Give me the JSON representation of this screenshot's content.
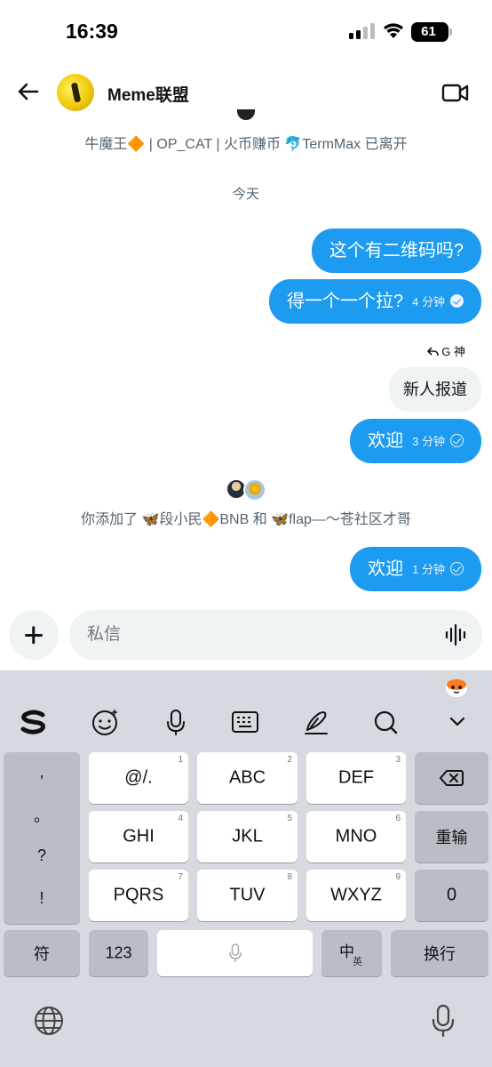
{
  "status_bar": {
    "time": "16:39",
    "battery": "61"
  },
  "header": {
    "title": "Meme联盟"
  },
  "chat": {
    "left_system": "牛魔王🔶 | OP_CAT | 火币赚币 🐬TermMax 已离开",
    "date": "今天",
    "messages": [
      {
        "text": "这个有二维码吗?"
      },
      {
        "text": "得一个一个拉?",
        "time": "4 分钟"
      }
    ],
    "reply_label": "G 神",
    "reply_quote": "新人报道",
    "welcome_1": {
      "text": "欢迎",
      "time": "3 分钟"
    },
    "added_system": "你添加了 🦋段小民🔶BNB 和 🦋flap—～苍社区才哥",
    "welcome_2": {
      "text": "欢迎",
      "time": "1 分钟"
    }
  },
  "composer": {
    "placeholder": "私信"
  },
  "keyboard": {
    "punctuation": [
      ",",
      "。",
      "?",
      "!"
    ],
    "rows": [
      [
        {
          "label": "@/.",
          "num": "1"
        },
        {
          "label": "ABC",
          "num": "2"
        },
        {
          "label": "DEF",
          "num": "3"
        }
      ],
      [
        {
          "label": "GHI",
          "num": "4"
        },
        {
          "label": "JKL",
          "num": "5"
        },
        {
          "label": "MNO",
          "num": "6"
        }
      ],
      [
        {
          "label": "PQRS",
          "num": "7"
        },
        {
          "label": "TUV",
          "num": "8"
        },
        {
          "label": "WXYZ",
          "num": "9"
        }
      ]
    ],
    "reinput": "重输",
    "zero": "0",
    "symbols": "符",
    "numbers": "123",
    "lang_main": "中",
    "lang_sub": "英",
    "enter": "换行"
  }
}
